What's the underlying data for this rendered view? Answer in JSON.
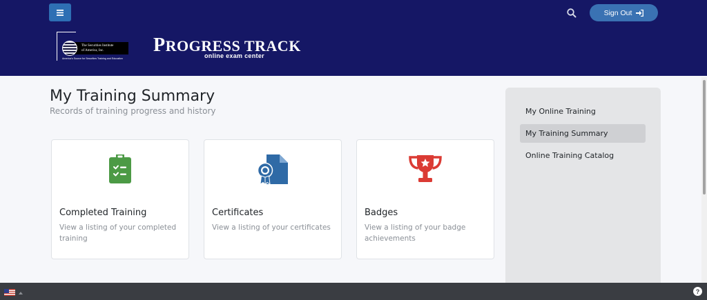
{
  "header": {
    "signout_label": "Sign Out",
    "logo": {
      "line1": "The Securities Institute",
      "line2": "of America, Inc.",
      "tagline": "America's Source for Securities Training and Education"
    },
    "brand_initial": "P",
    "brand_rest": "ROGRESS TRACK",
    "brand_sub": "online exam center"
  },
  "main": {
    "title": "My Training Summary",
    "subtitle": "Records of training progress and history",
    "cards": [
      {
        "title": "Completed Training",
        "desc": "View a listing of your completed training",
        "icon": "clipboard-check-icon",
        "color": "#4c9a45"
      },
      {
        "title": "Certificates",
        "desc": "View a listing of your certificates",
        "icon": "certificate-icon",
        "color": "#2f6aa6"
      },
      {
        "title": "Badges",
        "desc": "View a listing of your badge achievements",
        "icon": "trophy-icon",
        "color": "#db3b34"
      }
    ]
  },
  "sidebar": {
    "items": [
      {
        "label": "My Online Training"
      },
      {
        "label": "My Training Summary"
      },
      {
        "label": "Online Training Catalog"
      }
    ]
  },
  "footer": {
    "help_label": "?"
  }
}
